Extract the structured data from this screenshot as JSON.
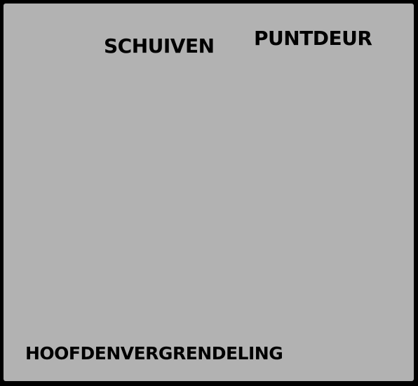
{
  "labels": {
    "top_left": "SCHUIVEN",
    "top_right": "PUNTDEUR",
    "bottom": "HOOFDENVERGRENDELING"
  },
  "colors": {
    "frame": "#000000",
    "panel": "#b2b2b2",
    "text": "#000000"
  }
}
